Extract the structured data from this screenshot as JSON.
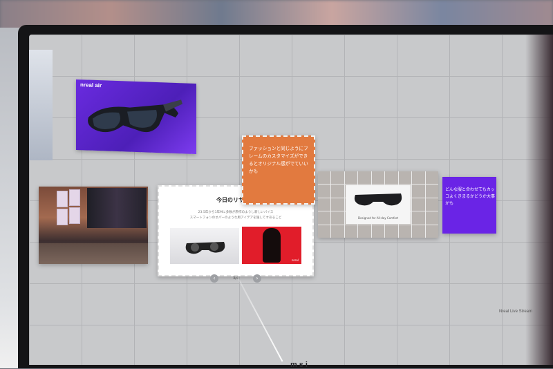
{
  "promo_panel": {
    "brand": "nreal air"
  },
  "main_card": {
    "title": "今日のリサーチ",
    "description_line1": "23.5年から1年Mに多数が原作のようし新しいバイス",
    "description_line2": "スマートフォンのオパーのような用アイデアを施してすあるこど",
    "image_tag": "nreal",
    "pager": {
      "current": "3/4"
    }
  },
  "orange_note": {
    "text": "ファッションと同じようにフレームのカスタマイズができるとオリジナル感がでていいかも"
  },
  "grid_panel": {
    "caption": "Designed for All-day Comfort"
  },
  "purple_note": {
    "text": "どんな服と合わせてもカッコよくきまるかどうか大事かも"
  },
  "watermark": "Nreal Live Stream",
  "bezel_logo": "msi",
  "colors": {
    "orange": "#e27a3f",
    "purple": "#6a24e6",
    "grid_bg": "#c8c9cb"
  }
}
